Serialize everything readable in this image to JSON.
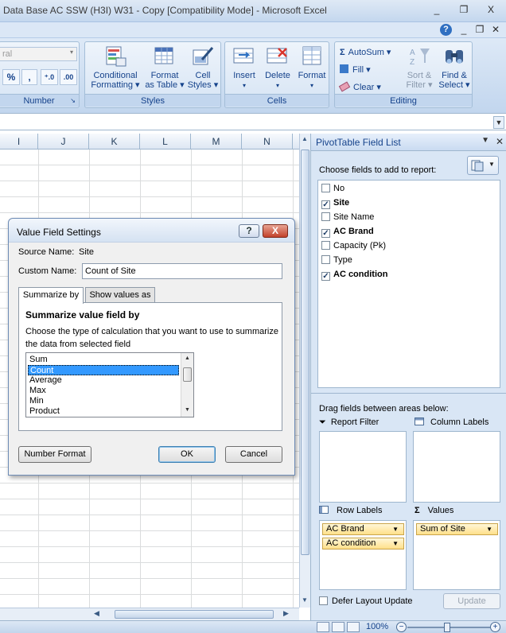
{
  "window": {
    "title": "Data Base AC SSW (H3I) W31 - Copy  [Compatibility Mode] - Microsoft Excel",
    "minimize": "_",
    "restore": "❐",
    "close": "X"
  },
  "ribbon": {
    "help": "?",
    "number_format_value": "ral",
    "number_symbols": [
      "%",
      ",",
      "⁺.0",
      ".00"
    ],
    "groups": {
      "number": "Number",
      "styles": "Styles",
      "cells": "Cells",
      "editing": "Editing"
    },
    "styles_buttons": {
      "conditional_formatting": [
        "Conditional",
        "Formatting ▾"
      ],
      "format_as_table": [
        "Format",
        "as Table ▾"
      ],
      "cell_styles": [
        "Cell",
        "Styles ▾"
      ]
    },
    "cells_buttons": {
      "insert": "Insert",
      "delete": "Delete",
      "format": "Format"
    },
    "editing_buttons": {
      "autosum": "AutoSum ▾",
      "fill": "Fill ▾",
      "clear": "Clear ▾",
      "sort_filter": [
        "Sort &",
        "Filter ▾"
      ],
      "find_select": [
        "Find &",
        "Select ▾"
      ]
    }
  },
  "sheet": {
    "columns": [
      "I",
      "J",
      "K",
      "L",
      "M",
      "N"
    ]
  },
  "pivot": {
    "title": "PivotTable Field List",
    "choose_text": "Choose fields to add to report:",
    "fields": [
      {
        "label": "No",
        "checked": false
      },
      {
        "label": "Site",
        "checked": true
      },
      {
        "label": "Site Name",
        "checked": false
      },
      {
        "label": "AC Brand",
        "checked": true
      },
      {
        "label": "Capacity (Pk)",
        "checked": false
      },
      {
        "label": "Type",
        "checked": false
      },
      {
        "label": "AC condition",
        "checked": true
      }
    ],
    "drag_text": "Drag fields between areas below:",
    "report_filter": "Report Filter",
    "column_labels": "Column Labels",
    "row_labels": "Row Labels",
    "values": "Values",
    "row_items": [
      "AC Brand",
      "AC condition"
    ],
    "value_items": [
      "Sum of Site"
    ],
    "defer_label": "Defer Layout Update",
    "update_label": "Update"
  },
  "dialog": {
    "title": "Value Field Settings",
    "help": "?",
    "close": "X",
    "source_name_label": "Source Name:",
    "source_name_value": "Site",
    "custom_name_label": "Custom Name:",
    "custom_name_value": "Count of Site",
    "tabs": [
      "Summarize by",
      "Show values as"
    ],
    "section_title": "Summarize value field by",
    "description_line1": "Choose the type of calculation that you want to use to summarize",
    "description_line2": "the data from selected field",
    "calc_options": [
      "Sum",
      "Count",
      "Average",
      "Max",
      "Min",
      "Product"
    ],
    "selected_option": "Count",
    "number_format_label": "Number Format",
    "ok_label": "OK",
    "cancel_label": "Cancel"
  },
  "status": {
    "zoom": "100%",
    "zoom_minus": "−",
    "zoom_plus": "+"
  }
}
